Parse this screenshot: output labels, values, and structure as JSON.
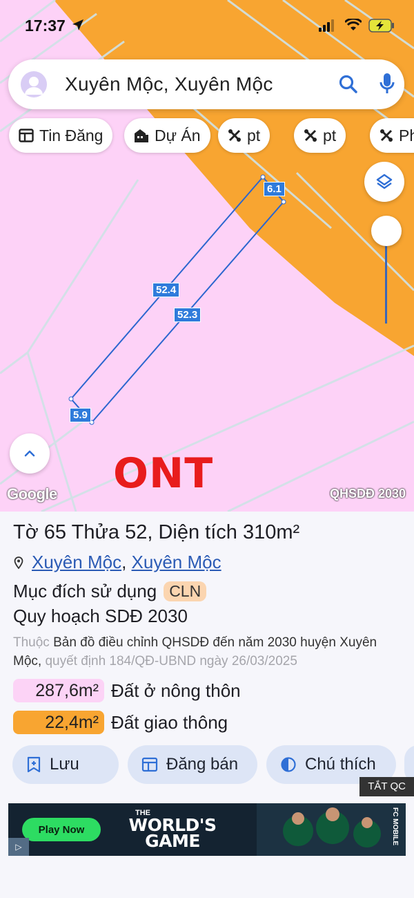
{
  "status_bar": {
    "time": "17:37"
  },
  "search": {
    "query": "Xuyên Mộc, Xuyên Mộc"
  },
  "chips": [
    {
      "label": "Tin Đăng",
      "icon": "listing-icon"
    },
    {
      "label": "Dự Án",
      "icon": "building-icon"
    },
    {
      "label": "pt",
      "icon": "tools-icon"
    },
    {
      "label": "pt",
      "icon": "tools-icon"
    },
    {
      "label": "Ph",
      "icon": "tools-icon"
    }
  ],
  "map": {
    "dimensions": [
      "6.1",
      "52.4",
      "52.3",
      "5.9"
    ],
    "zone_label": "ONT",
    "attribution": "Google",
    "layer_name": "QHSDĐ 2030",
    "colors": {
      "residential_zone": "#fdd2f7",
      "road_zone": "#f8a531",
      "parcel_outline": "#2b66cf"
    }
  },
  "parcel": {
    "title_prefix": "Tờ",
    "sheet": "65",
    "plot_prefix": "Thửa",
    "plot": "52",
    "area_prefix": "Diện tích",
    "area": "310m²",
    "location_commune": "Xuyên Mộc",
    "location_district": "Xuyên Mộc",
    "purpose_label": "Mục đích sử dụng",
    "purpose_code": "CLN",
    "plan_title": "Quy hoạch SDĐ 2030",
    "desc_prefix": "Thuộc",
    "desc_main": "Bản đồ điều chỉnh QHSDĐ đến năm 2030 huyện Xuyên Mộc,",
    "desc_decision": "quyết định 184/QĐ-UBND ngày 26/03/2025",
    "areas": [
      {
        "value": "287,6m²",
        "label": "Đất ở nông thôn",
        "color": "#fcd3f6"
      },
      {
        "value": "22,4m²",
        "label": "Đất giao thông",
        "color": "#f8a531"
      }
    ]
  },
  "actions": [
    {
      "label": "Lưu",
      "icon": "bookmark-add-icon"
    },
    {
      "label": "Đăng bán",
      "icon": "listing-icon"
    },
    {
      "label": "Chú thích",
      "icon": "contrast-icon"
    }
  ],
  "ad": {
    "hide_label": "TẮT QC",
    "cta": "Play Now",
    "pre_title": "THE",
    "title": "WORLD'S GAME",
    "brand": "FC MOBILE"
  }
}
